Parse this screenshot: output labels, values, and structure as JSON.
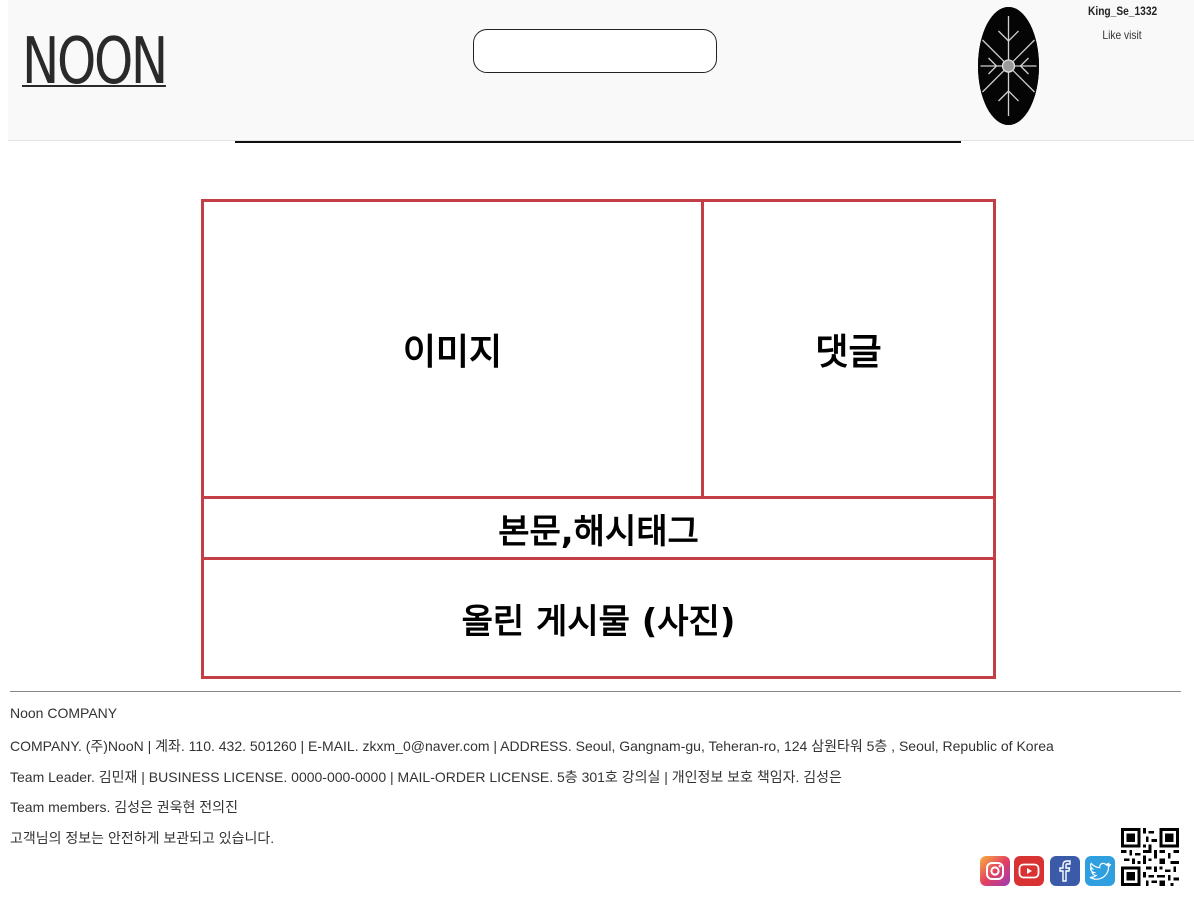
{
  "header": {
    "logo_text": "NOON",
    "search": {
      "value": "",
      "placeholder": ""
    },
    "user": {
      "name": "King_Se_1332",
      "status": "Like visit"
    }
  },
  "layout_boxes": {
    "image": "이미지",
    "comments": "댓글",
    "body_hashtags": "본문,해시태그",
    "uploaded_posts": "올린 게시물 (사진)"
  },
  "footer": {
    "company_name": "Noon COMPANY",
    "line_company": "COMPANY. (주)NooN | 계좌. 110. 432. 501260 | E-MAIL. zkxm_0@naver.com | ADDRESS. Seoul, Gangnam-gu, Teheran-ro, 124 삼원타워 5층 , Seoul, Republic of Korea",
    "line_leader": "Team Leader. 김민재 | BUSINESS LICENSE. 0000-000-0000 | MAIL-ORDER LICENSE. 5층 301호 강의실 | 개인정보 보호 책임자. 김성은",
    "line_members": "Team members. 김성은 권욱현 전의진",
    "line_privacy": "고객님의 정보는 안전하게 보관되고 있습니다."
  },
  "social_icons": [
    "instagram-icon",
    "youtube-icon",
    "facebook-icon",
    "twitter-icon",
    "qr-code-icon"
  ],
  "colors": {
    "wireframe_border": "#c43f45",
    "header_bg": "#f9f9f9",
    "instagram": "#e4405f",
    "youtube": "#d93232",
    "facebook": "#3b5aa8",
    "twitter": "#2f9fe0"
  }
}
